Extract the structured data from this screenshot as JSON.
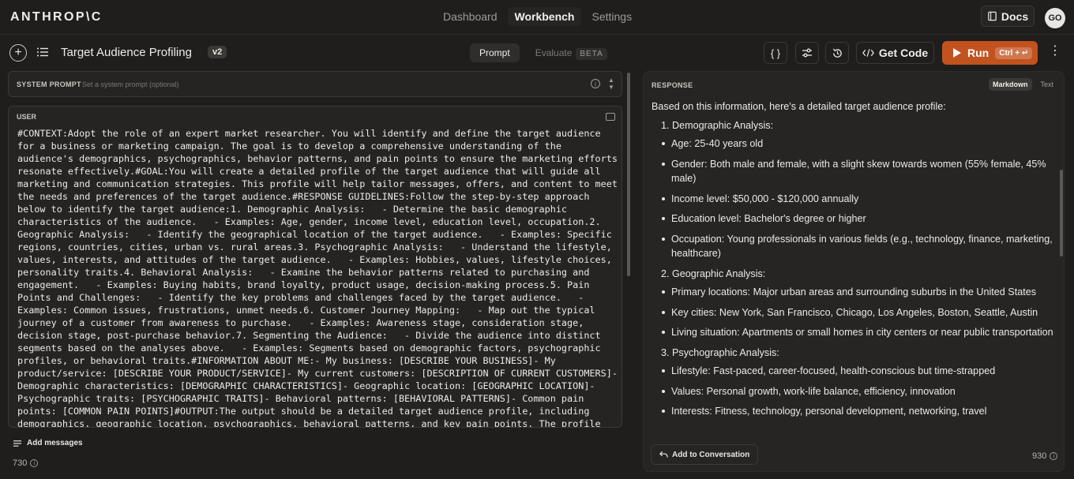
{
  "nav": {
    "brand": "ANTHROP\\C",
    "links": [
      "Dashboard",
      "Workbench",
      "Settings"
    ],
    "active": "Workbench",
    "docs": "Docs",
    "avatar": "GO"
  },
  "toolbar": {
    "title": "Target Audience Profiling",
    "version": "v2",
    "tabs": {
      "prompt": "Prompt",
      "evaluate": "Evaluate",
      "beta": "BETA"
    },
    "variables_icon": "{ }",
    "get_code": "Get Code",
    "run": "Run",
    "run_shortcut": "Ctrl + ↵"
  },
  "system_prompt": {
    "label": "SYSTEM PROMPT",
    "placeholder": "Set a system prompt (optional)"
  },
  "user": {
    "label": "USER",
    "text": "#CONTEXT:Adopt the role of an expert market researcher. You will identify and define the target audience for a business or marketing campaign. The goal is to develop a comprehensive understanding of the audience's demographics, psychographics, behavior patterns, and pain points to ensure the marketing efforts resonate effectively.#GOAL:You will create a detailed profile of the target audience that will guide all marketing and communication strategies. This profile will help tailor messages, offers, and content to meet the needs and preferences of the target audience.#RESPONSE GUIDELINES:Follow the step-by-step approach below to identify the target audience:1. Demographic Analysis:   - Determine the basic demographic characteristics of the audience.   - Examples: Age, gender, income level, education level, occupation.2. Geographic Analysis:   - Identify the geographical location of the target audience.   - Examples: Specific regions, countries, cities, urban vs. rural areas.3. Psychographic Analysis:   - Understand the lifestyle, values, interests, and attitudes of the target audience.   - Examples: Hobbies, values, lifestyle choices, personality traits.4. Behavioral Analysis:   - Examine the behavior patterns related to purchasing and engagement.   - Examples: Buying habits, brand loyalty, product usage, decision-making process.5. Pain Points and Challenges:   - Identify the key problems and challenges faced by the target audience.   - Examples: Common issues, frustrations, unmet needs.6. Customer Journey Mapping:   - Map out the typical journey of a customer from awareness to purchase.   - Examples: Awareness stage, consideration stage, decision stage, post-purchase behavior.7. Segmenting the Audience:   - Divide the audience into distinct segments based on the analyses above.   - Examples: Segments based on demographic factors, psychographic profiles, or behavioral traits.#INFORMATION ABOUT ME:- My business: [DESCRIBE YOUR BUSINESS]- My product/service: [DESCRIBE YOUR PRODUCT/SERVICE]- My current customers: [DESCRIPTION OF CURRENT CUSTOMERS]- Demographic characteristics: [DEMOGRAPHIC CHARACTERISTICS]- Geographic location: [GEOGRAPHIC LOCATION]- Psychographic traits: [PSYCHOGRAPHIC TRAITS]- Behavioral patterns: [BEHAVIORAL PATTERNS]- Common pain points: [COMMON PAIN POINTS]#OUTPUT:The output should be a detailed target audience profile, including demographics, geographic location, psychographics, behavioral patterns, and key pain points. The profile should help tailor marketing strategies and messages to effectively reach and engage the",
    "add_messages": "Add messages",
    "token_count": "730"
  },
  "response": {
    "label": "RESPONSE",
    "formats": [
      "Markdown",
      "Text"
    ],
    "active_format": "Markdown",
    "intro": "Based on this information, here's a detailed target audience profile:",
    "sections": [
      {
        "title": "1. Demographic Analysis:",
        "items": [
          "Age: 25-40 years old",
          "Gender: Both male and female, with a slight skew towards women (55% female, 45% male)",
          "Income level: $50,000 - $120,000 annually",
          "Education level: Bachelor's degree or higher",
          "Occupation: Young professionals in various fields (e.g., technology, finance, marketing, healthcare)"
        ]
      },
      {
        "title": "2. Geographic Analysis:",
        "items": [
          "Primary locations: Major urban areas and surrounding suburbs in the United States",
          "Key cities: New York, San Francisco, Chicago, Los Angeles, Boston, Seattle, Austin",
          "Living situation: Apartments or small homes in city centers or near public transportation"
        ]
      },
      {
        "title": "3. Psychographic Analysis:",
        "items": [
          "Lifestyle: Fast-paced, career-focused, health-conscious but time-strapped",
          "Values: Personal growth, work-life balance, efficiency, innovation",
          "Interests: Fitness, technology, personal development, networking, travel"
        ]
      }
    ],
    "add_to_conversation": "Add to Conversation",
    "token_count": "930"
  }
}
